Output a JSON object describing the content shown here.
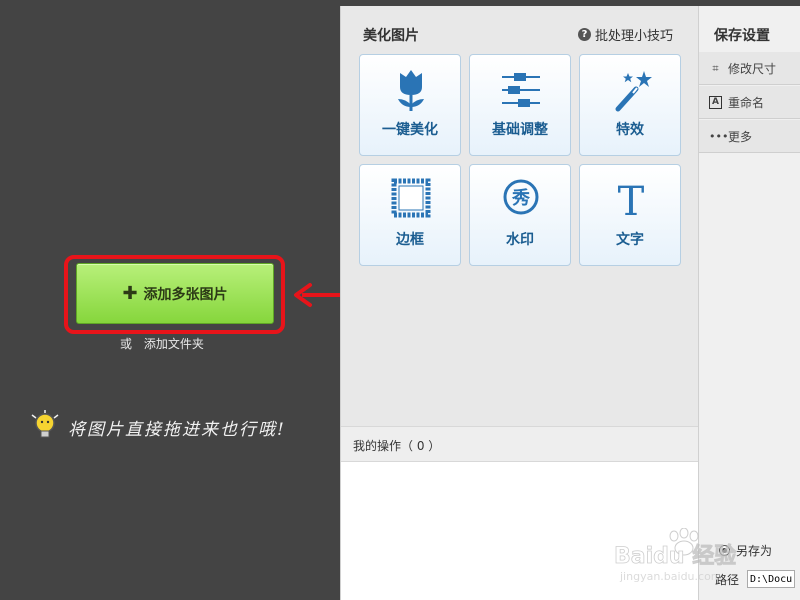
{
  "left": {
    "add_button_label": "添加多张图片",
    "add_folder_or": "或",
    "add_folder_label": "添加文件夹",
    "drag_hint": "将图片直接拖进来也行哦!"
  },
  "beautify": {
    "title": "美化图片",
    "tips_label": "批处理小技巧",
    "tools": [
      {
        "label": "一键美化",
        "icon": "tulip-icon"
      },
      {
        "label": "基础调整",
        "icon": "sliders-icon"
      },
      {
        "label": "特效",
        "icon": "magic-wand-icon"
      },
      {
        "label": "边框",
        "icon": "frame-icon"
      },
      {
        "label": "水印",
        "icon": "watermark-seal-icon"
      },
      {
        "label": "文字",
        "icon": "text-t-icon"
      }
    ],
    "ops_label": "我的操作（ 0 ）"
  },
  "save": {
    "title": "保存设置",
    "items": [
      {
        "label": "修改尺寸",
        "icon": "crop-icon"
      },
      {
        "label": "重命名",
        "icon": "rename-a-icon"
      },
      {
        "label": "更多",
        "icon": "more-dots-icon"
      }
    ],
    "save_as_label": "另存为",
    "path_label": "路径",
    "path_value": "D:\\Docu"
  },
  "watermark": {
    "text": "Baidu 经验",
    "url": "jingyan.baidu.com"
  },
  "colors": {
    "background": "#444444",
    "highlight_red": "#e8141a",
    "button_green": "#86d63c",
    "tool_blue": "#1b5d91"
  }
}
